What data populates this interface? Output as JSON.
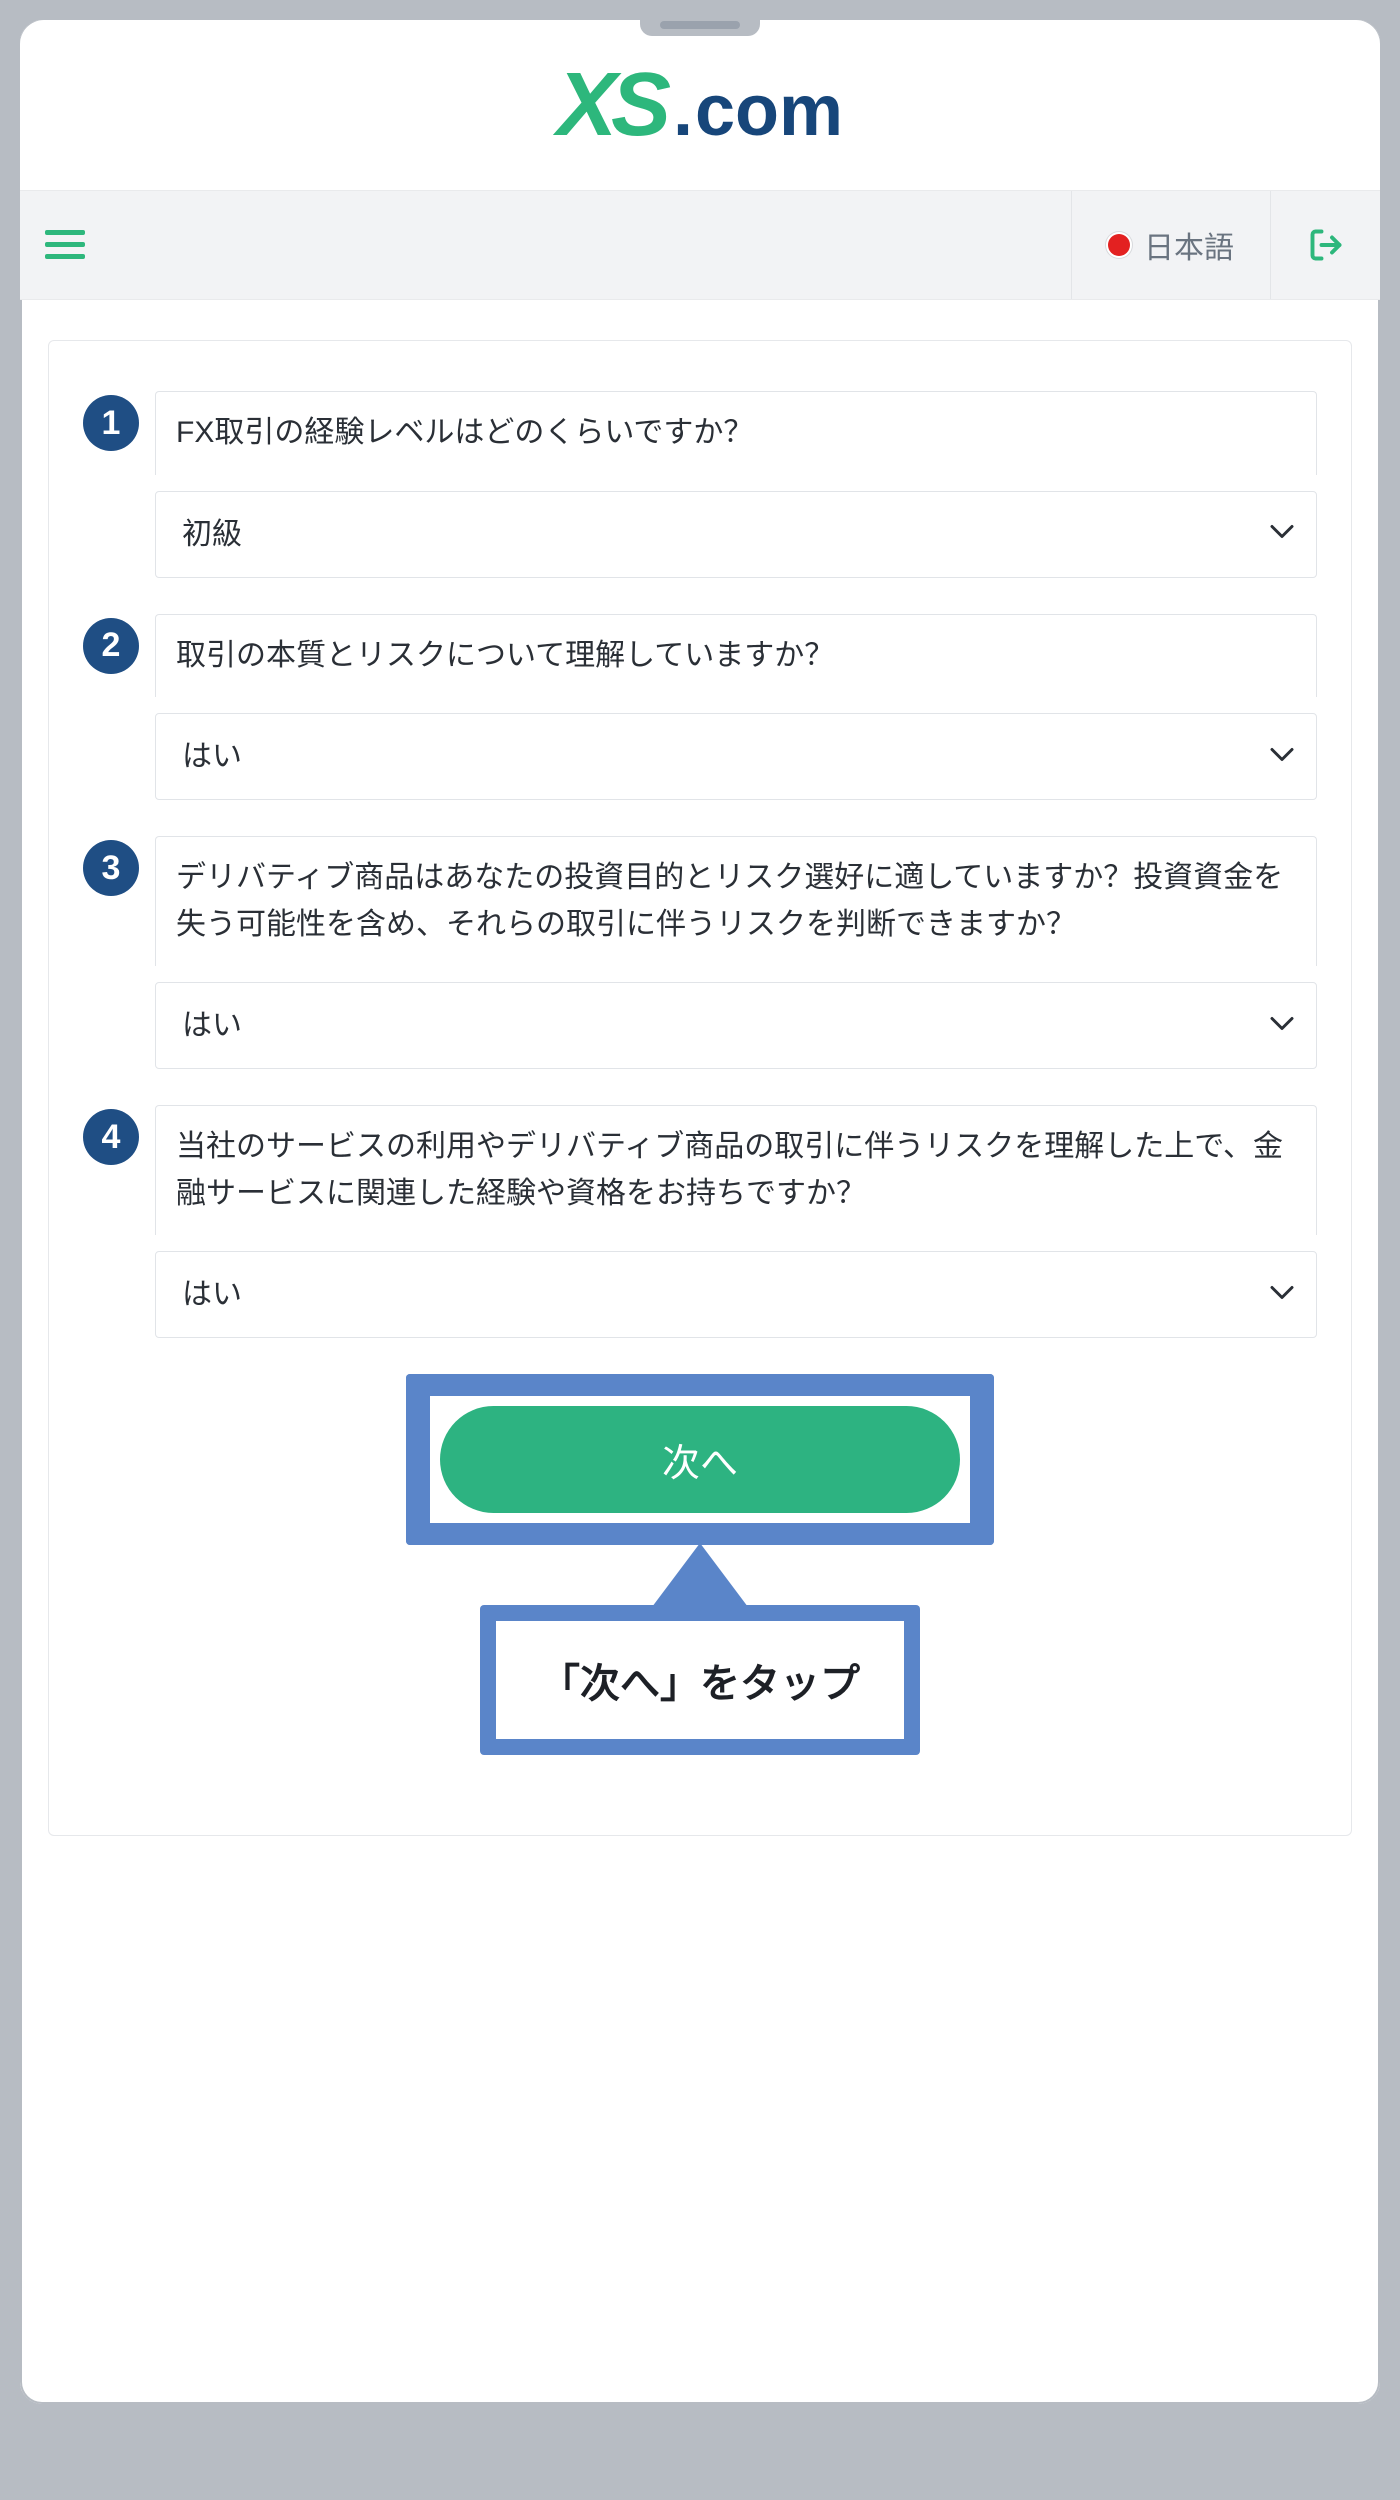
{
  "brand": {
    "xs": "XS",
    "dotcom_dot": ".",
    "dotcom_com": "com"
  },
  "toolbar": {
    "language_label": "日本語"
  },
  "questions": [
    {
      "num": "1",
      "label": "FX取引の経験レベルはどのくらいですか？",
      "value": "初級"
    },
    {
      "num": "2",
      "label": "取引の本質とリスクについて理解していますか？",
      "value": "はい"
    },
    {
      "num": "3",
      "label": "デリバティブ商品はあなたの投資目的とリスク選好に適していますか？投資資金を失う可能性を含め、それらの取引に伴うリスクを判断できますか？",
      "value": "はい"
    },
    {
      "num": "4",
      "label": "当社のサービスの利用やデリバティブ商品の取引に伴うリスクを理解した上で、金融サービスに関連した経験や資格をお持ちですか？",
      "value": "はい"
    }
  ],
  "cta": {
    "next_label": "次へ"
  },
  "callout": {
    "text": "「次へ」をタップ"
  }
}
